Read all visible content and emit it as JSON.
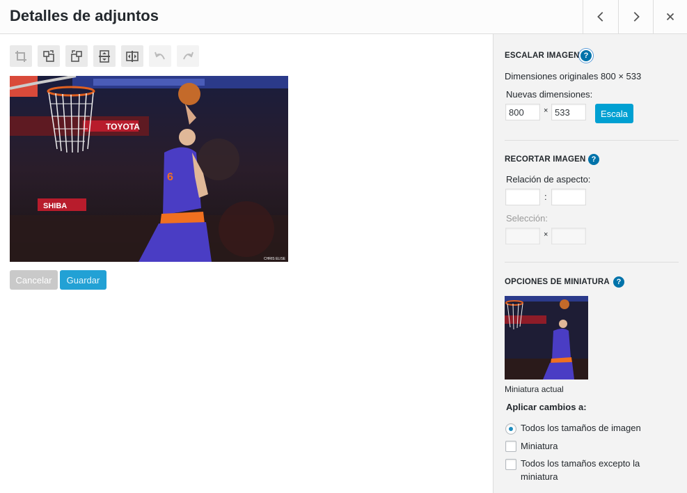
{
  "header": {
    "title": "Detalles de adjuntos",
    "prev_icon": "chevron-left-icon",
    "next_icon": "chevron-right-icon",
    "close_icon": "close-icon"
  },
  "toolbar": {
    "crop": "crop-icon",
    "rotate_left": "rotate-left-icon",
    "rotate_right": "rotate-right-icon",
    "flip_vertical": "flip-vertical-icon",
    "flip_horizontal": "flip-horizontal-icon",
    "undo": "undo-icon",
    "redo": "redo-icon"
  },
  "image": {
    "credit": "CHRIS ELISE"
  },
  "actions": {
    "cancel": "Cancelar",
    "save": "Guardar"
  },
  "scale": {
    "title": "Escalar imagen",
    "original": "Dimensiones originales 800 × 533",
    "new_label": "Nuevas dimensiones:",
    "width": "800",
    "times": "×",
    "height": "533",
    "button": "Escala"
  },
  "crop": {
    "title": "Recortar imagen",
    "ratio_label": "Relación de aspecto:",
    "ratio_sep": ":",
    "ratio_w": "",
    "ratio_h": "",
    "selection_label": "Selección:",
    "sel_sep": "×",
    "sel_w": "",
    "sel_h": ""
  },
  "thumbnail": {
    "title": "Opciones de miniatura",
    "caption": "Miniatura actual",
    "apply_label": "Aplicar cambios a:",
    "options": [
      {
        "label": "Todos los tamaños de imagen",
        "checked": true
      },
      {
        "label": "Miniatura",
        "checked": false
      },
      {
        "label": "Todos los tamaños excepto la miniatura",
        "checked": false
      }
    ]
  },
  "help_icon": "help-icon",
  "colors": {
    "accent": "#00a0d2",
    "help": "#0073aa",
    "sidebar_bg": "#f3f3f3"
  }
}
